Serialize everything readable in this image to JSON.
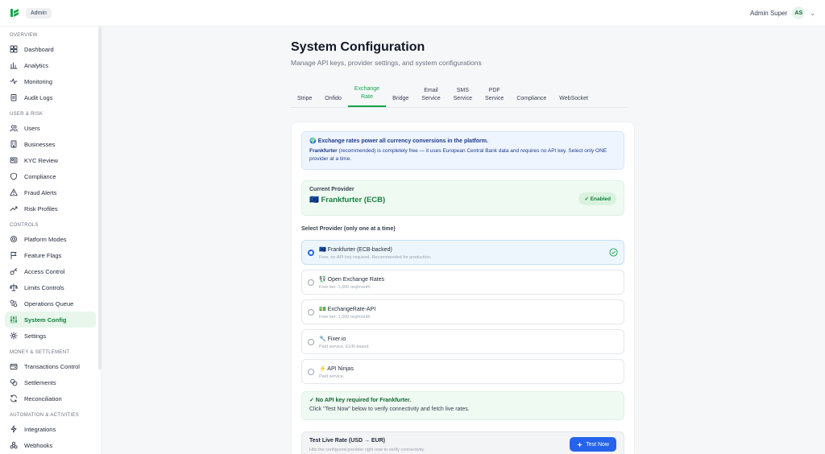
{
  "topbar": {
    "badge": "Admin",
    "user_name": "Admin Super",
    "avatar_initials": "AS",
    "brand_color": "#16a34a"
  },
  "sidebar": {
    "sections": [
      {
        "title": "OVERVIEW",
        "items": [
          {
            "label": "Dashboard",
            "icon": "grid-icon"
          },
          {
            "label": "Analytics",
            "icon": "bar-chart-icon"
          },
          {
            "label": "Monitoring",
            "icon": "activity-icon"
          },
          {
            "label": "Audit Logs",
            "icon": "clipboard-icon"
          }
        ]
      },
      {
        "title": "USER & RISK",
        "items": [
          {
            "label": "Users",
            "icon": "users-icon"
          },
          {
            "label": "Businesses",
            "icon": "building-icon"
          },
          {
            "label": "KYC Review",
            "icon": "id-card-icon"
          },
          {
            "label": "Compliance",
            "icon": "shield-icon"
          },
          {
            "label": "Fraud Alerts",
            "icon": "alert-triangle-icon"
          },
          {
            "label": "Risk Profiles",
            "icon": "trending-icon"
          }
        ]
      },
      {
        "title": "CONTROLS",
        "items": [
          {
            "label": "Platform Modes",
            "icon": "settings-cog-icon"
          },
          {
            "label": "Feature Flags",
            "icon": "flag-icon"
          },
          {
            "label": "Access Control",
            "icon": "key-icon"
          },
          {
            "label": "Limits Controls",
            "icon": "scale-icon"
          },
          {
            "label": "Operations Queue",
            "icon": "queue-icon"
          },
          {
            "label": "System Config",
            "icon": "sliders-icon",
            "active": true
          },
          {
            "label": "Settings",
            "icon": "gear-icon"
          }
        ]
      },
      {
        "title": "MONEY & SETTLEMENT",
        "items": [
          {
            "label": "Transactions Control",
            "icon": "wallet-icon"
          },
          {
            "label": "Settlements",
            "icon": "coins-icon"
          },
          {
            "label": "Reconciliation",
            "icon": "refresh-icon"
          }
        ]
      },
      {
        "title": "AUTOMATION & ACTIVITIES",
        "items": [
          {
            "label": "Integrations",
            "icon": "zap-icon"
          },
          {
            "label": "Webhooks",
            "icon": "webhook-icon"
          }
        ]
      }
    ]
  },
  "page": {
    "title": "System Configuration",
    "subtitle": "Manage API keys, provider settings, and system configurations"
  },
  "tabs": [
    {
      "line1": "Stripe",
      "line2": ""
    },
    {
      "line1": "Onfido",
      "line2": ""
    },
    {
      "line1": "Exchange",
      "line2": "Rate",
      "active": true
    },
    {
      "line1": "Bridge",
      "line2": ""
    },
    {
      "line1": "Email",
      "line2": "Service"
    },
    {
      "line1": "SMS",
      "line2": "Service"
    },
    {
      "line1": "PDF",
      "line2": "Service"
    },
    {
      "line1": "Compliance",
      "line2": ""
    },
    {
      "line1": "WebSocket",
      "line2": ""
    }
  ],
  "info": {
    "title": "🌍 Exchange rates power all currency conversions in the platform.",
    "bold": "Frankfurter",
    "text": " (recommended) is completely free — it uses European Central Bank data and requires no API key. Select only ONE provider at a time."
  },
  "current": {
    "label": "Current Provider",
    "value": "🇪🇺 Frankfurter (ECB)",
    "status": "✓ Enabled"
  },
  "select_label": "Select Provider (only one at a time)",
  "providers": [
    {
      "title": "🇪🇺 Frankfurter (ECB-backed)",
      "sub": "Free, no API key required. Recommended for production.",
      "selected": true
    },
    {
      "title": "💱 Open Exchange Rates",
      "sub": "Free tier: 1,000 req/month",
      "selected": false
    },
    {
      "title": "💵 ExchangeRate-API",
      "sub": "Free tier: 1,500 req/month",
      "selected": false
    },
    {
      "title": "🔧 Fixer.io",
      "sub": "Paid service. EUR-based.",
      "selected": false
    },
    {
      "title": "⚡ API Ninjas",
      "sub": "Paid service.",
      "selected": false
    }
  ],
  "note": {
    "title": "✓ No API key required for Frankfurter.",
    "text": "Click \"Test Now\" below to verify connectivity and fetch live rates."
  },
  "test": {
    "title": "Test Live Rate (USD → EUR)",
    "sub": "Hits the configured provider right now to verify connectivity.",
    "button": "Test Now"
  }
}
